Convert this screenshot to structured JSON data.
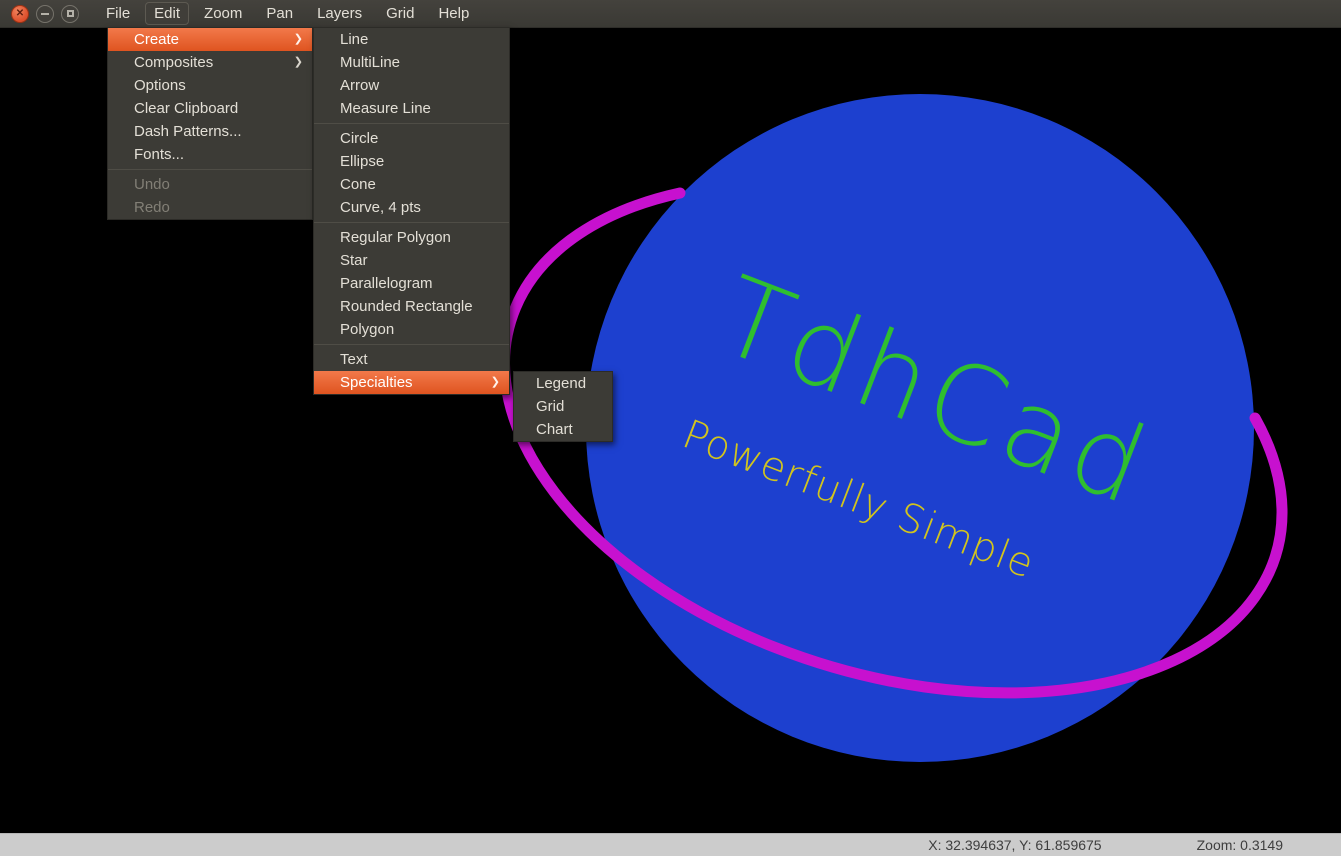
{
  "menubar": {
    "items": [
      {
        "label": "File"
      },
      {
        "label": "Edit"
      },
      {
        "label": "Zoom"
      },
      {
        "label": "Pan"
      },
      {
        "label": "Layers"
      },
      {
        "label": "Grid"
      },
      {
        "label": "Help"
      }
    ],
    "active_item": "Edit"
  },
  "window_controls": {
    "close_glyph": "✕"
  },
  "icons": {
    "submenu_arrow": "❯"
  },
  "edit_menu": {
    "items": [
      {
        "label": "Create",
        "has_submenu": true,
        "highlighted": true
      },
      {
        "label": "Composites",
        "has_submenu": true
      },
      {
        "label": "Options"
      },
      {
        "label": "Clear Clipboard"
      },
      {
        "label": "Dash Patterns..."
      },
      {
        "label": "Fonts..."
      },
      {
        "label": "Undo",
        "disabled": true
      },
      {
        "label": "Redo",
        "disabled": true
      }
    ]
  },
  "create_menu": {
    "items": [
      "Line",
      "MultiLine",
      "Arrow",
      "Measure Line",
      "Circle",
      "Ellipse",
      "Cone",
      "Curve, 4 pts",
      "Regular Polygon",
      "Star",
      "Parallelogram",
      "Rounded Rectangle",
      "Polygon",
      "Text",
      "Specialties"
    ],
    "highlighted_item": "Specialties"
  },
  "specialties_menu": {
    "items": [
      "Legend",
      "Grid",
      "Chart"
    ]
  },
  "canvas": {
    "logo_text": "TdhCad",
    "tagline": "Powerfully Simple",
    "colors": {
      "background": "#000000",
      "planet_fill": "#1d40cf",
      "ring_stroke": "#c711cf",
      "logo_green": "#2fbe2f",
      "tagline_yellow": "#d2c41d",
      "menu_highlight": "#e95b26"
    }
  },
  "statusbar": {
    "coordinates": "X: 32.394637, Y: 61.859675",
    "zoom": "Zoom: 0.3149"
  }
}
